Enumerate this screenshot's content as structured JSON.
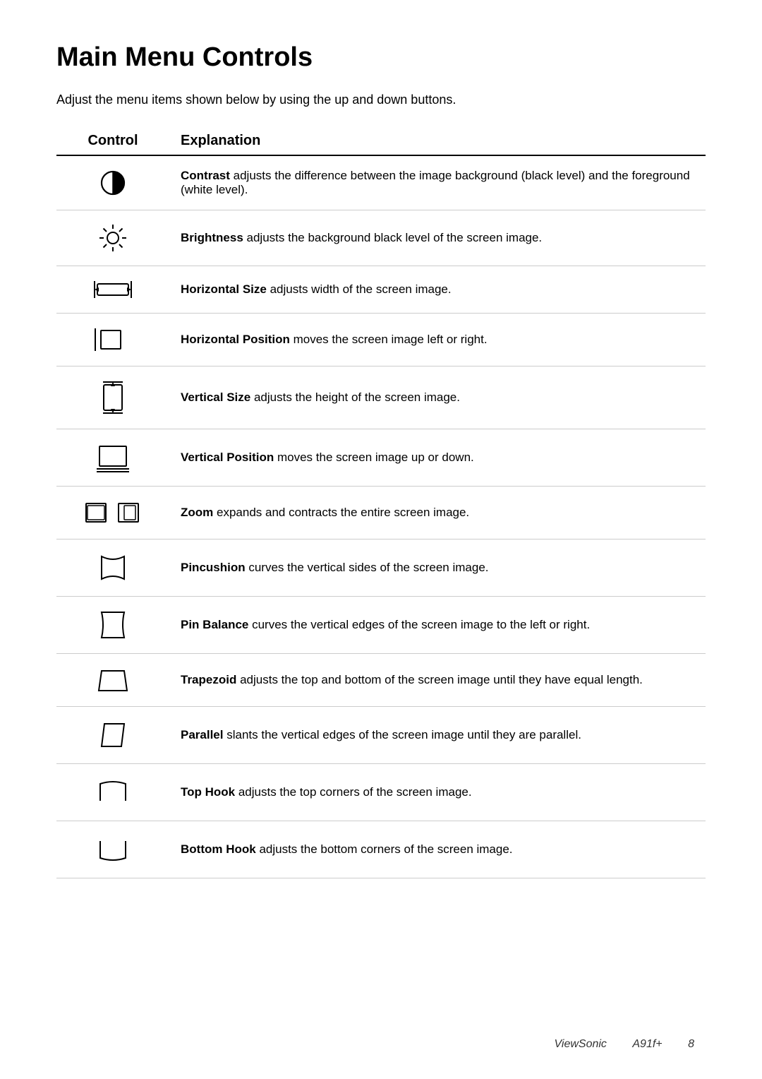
{
  "page": {
    "title": "Main Menu Controls",
    "intro": "Adjust the menu items shown below by using the up and down buttons.",
    "table": {
      "col_control": "Control",
      "col_explanation": "Explanation"
    },
    "rows": [
      {
        "icon": "contrast",
        "bold": "Contrast",
        "text": " adjusts the difference between the image background (black level) and the foreground (white level)."
      },
      {
        "icon": "brightness",
        "bold": "Brightness",
        "text": " adjusts the background black level of the screen image."
      },
      {
        "icon": "horizontal-size",
        "bold": "Horizontal Size",
        "text": " adjusts width of the screen image."
      },
      {
        "icon": "horizontal-position",
        "bold": "Horizontal Position",
        "text": " moves the screen image left or right."
      },
      {
        "icon": "vertical-size",
        "bold": "Vertical Size",
        "text": " adjusts the height of the screen image."
      },
      {
        "icon": "vertical-position",
        "bold": "Vertical Position",
        "text": " moves the screen image up or down."
      },
      {
        "icon": "zoom",
        "bold": "Zoom",
        "text": " expands and contracts the entire screen image."
      },
      {
        "icon": "pincushion",
        "bold": "Pincushion",
        "text": " curves the vertical sides of the screen image."
      },
      {
        "icon": "pin-balance",
        "bold": "Pin Balance",
        "text": " curves the vertical edges of the screen image to the left or right."
      },
      {
        "icon": "trapezoid",
        "bold": "Trapezoid",
        "text": " adjusts the top and bottom of the screen image until they have equal length."
      },
      {
        "icon": "parallel",
        "bold": "Parallel",
        "text": " slants the vertical edges of the screen image until they are parallel."
      },
      {
        "icon": "top-hook",
        "bold": "Top Hook",
        "text": " adjusts the top corners of the screen image."
      },
      {
        "icon": "bottom-hook",
        "bold": "Bottom Hook",
        "text": " adjusts the bottom corners of the screen image."
      }
    ],
    "footer": {
      "brand": "ViewSonic",
      "model": "A91f+",
      "page": "8"
    }
  }
}
